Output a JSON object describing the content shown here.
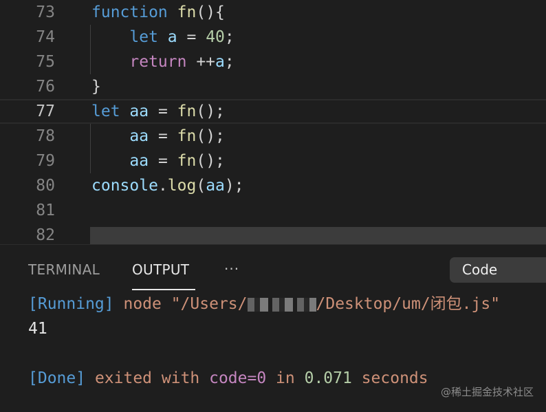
{
  "editor": {
    "lines": [
      {
        "num": "73",
        "tokens": [
          {
            "t": "function",
            "c": "k"
          },
          {
            "t": " ",
            "c": "p"
          },
          {
            "t": "fn",
            "c": "f"
          },
          {
            "t": "(){",
            "c": "p"
          }
        ]
      },
      {
        "num": "74",
        "tokens": [
          {
            "t": "    ",
            "c": "p"
          },
          {
            "t": "let",
            "c": "k"
          },
          {
            "t": " ",
            "c": "p"
          },
          {
            "t": "a",
            "c": "v"
          },
          {
            "t": " = ",
            "c": "p"
          },
          {
            "t": "40",
            "c": "n"
          },
          {
            "t": ";",
            "c": "p"
          }
        ]
      },
      {
        "num": "75",
        "tokens": [
          {
            "t": "    ",
            "c": "p"
          },
          {
            "t": "return",
            "c": "r"
          },
          {
            "t": " ++",
            "c": "p"
          },
          {
            "t": "a",
            "c": "v"
          },
          {
            "t": ";",
            "c": "p"
          }
        ]
      },
      {
        "num": "76",
        "tokens": [
          {
            "t": "}",
            "c": "p"
          }
        ]
      },
      {
        "num": "77",
        "tokens": [
          {
            "t": "let",
            "c": "k"
          },
          {
            "t": " ",
            "c": "p"
          },
          {
            "t": "aa",
            "c": "v"
          },
          {
            "t": " = ",
            "c": "p"
          },
          {
            "t": "fn",
            "c": "f"
          },
          {
            "t": "();",
            "c": "p"
          }
        ]
      },
      {
        "num": "78",
        "tokens": [
          {
            "t": "    ",
            "c": "p"
          },
          {
            "t": "aa",
            "c": "v"
          },
          {
            "t": " = ",
            "c": "p"
          },
          {
            "t": "fn",
            "c": "f"
          },
          {
            "t": "();",
            "c": "p"
          }
        ]
      },
      {
        "num": "79",
        "tokens": [
          {
            "t": "    ",
            "c": "p"
          },
          {
            "t": "aa",
            "c": "v"
          },
          {
            "t": " = ",
            "c": "p"
          },
          {
            "t": "fn",
            "c": "f"
          },
          {
            "t": "();",
            "c": "p"
          }
        ]
      },
      {
        "num": "80",
        "tokens": [
          {
            "t": "console",
            "c": "v"
          },
          {
            "t": ".",
            "c": "p"
          },
          {
            "t": "log",
            "c": "f"
          },
          {
            "t": "(",
            "c": "p"
          },
          {
            "t": "aa",
            "c": "v"
          },
          {
            "t": ");",
            "c": "p"
          }
        ]
      },
      {
        "num": "81",
        "tokens": []
      },
      {
        "num": "82",
        "tokens": []
      }
    ]
  },
  "panel": {
    "tabs": {
      "terminal": "TERMINAL",
      "output": "OUTPUT",
      "more": "···"
    },
    "dropdown": {
      "selected": "Code"
    },
    "output": {
      "running_tag": "[Running]",
      "command_prefix": " node \"/Users/",
      "command_suffix": "/Desktop/um/闭包.js\"",
      "result": "41",
      "done_tag": "[Done]",
      "exit_text": " exited with ",
      "code_text": "code=0",
      "in_text": " in ",
      "duration": "0.071",
      "seconds_text": " seconds"
    }
  },
  "watermark": "@稀土掘金技术社区"
}
